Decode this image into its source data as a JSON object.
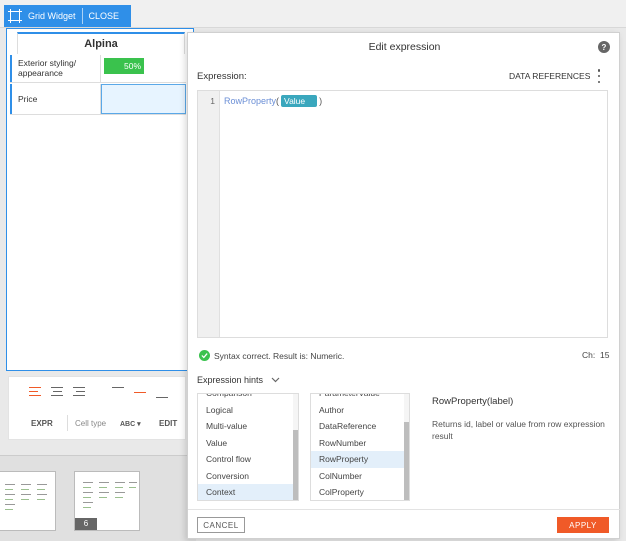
{
  "widget_tab": {
    "title": "Grid Widget",
    "close_label": "CLOSE"
  },
  "grid": {
    "header": "Alpina",
    "rows": [
      {
        "label": "Exterior styling/ appearance",
        "value": "50%",
        "progress": 0.5
      },
      {
        "label": "Price",
        "value": ""
      }
    ]
  },
  "toolbar": {
    "expr_label": "EXPR",
    "cell_type_label": "Cell type",
    "cell_type_value": "ABC",
    "edit_label": "EDIT"
  },
  "thumbnails": {
    "badge": "6"
  },
  "modal": {
    "title": "Edit expression",
    "expression_label": "Expression:",
    "data_references_label": "DATA REFERENCES",
    "editor": {
      "line_number": "1",
      "function_name": "RowProperty",
      "open_paren": "(",
      "token": "Value",
      "close_paren": ")"
    },
    "syntax_status": "Syntax correct. Result is: Numeric.",
    "char_count_label": "Ch:",
    "char_count_value": "15",
    "hints_label": "Expression hints",
    "categories": [
      "Comparison",
      "Logical",
      "Multi-value",
      "Value",
      "Control flow",
      "Conversion",
      "Context"
    ],
    "selected_category": "Context",
    "functions": [
      "ParameterValue",
      "Author",
      "DataReference",
      "RowNumber",
      "RowProperty",
      "ColNumber",
      "ColProperty"
    ],
    "selected_function": "RowProperty",
    "hint_signature": "RowProperty(label)",
    "hint_description": "Returns id, label or value from row expression result",
    "cancel_label": "CANCEL",
    "apply_label": "APPLY"
  },
  "colors": {
    "accent": "#2f8fe8",
    "apply": "#f05a28",
    "success": "#3ac24d",
    "token": "#3aa7bd"
  }
}
